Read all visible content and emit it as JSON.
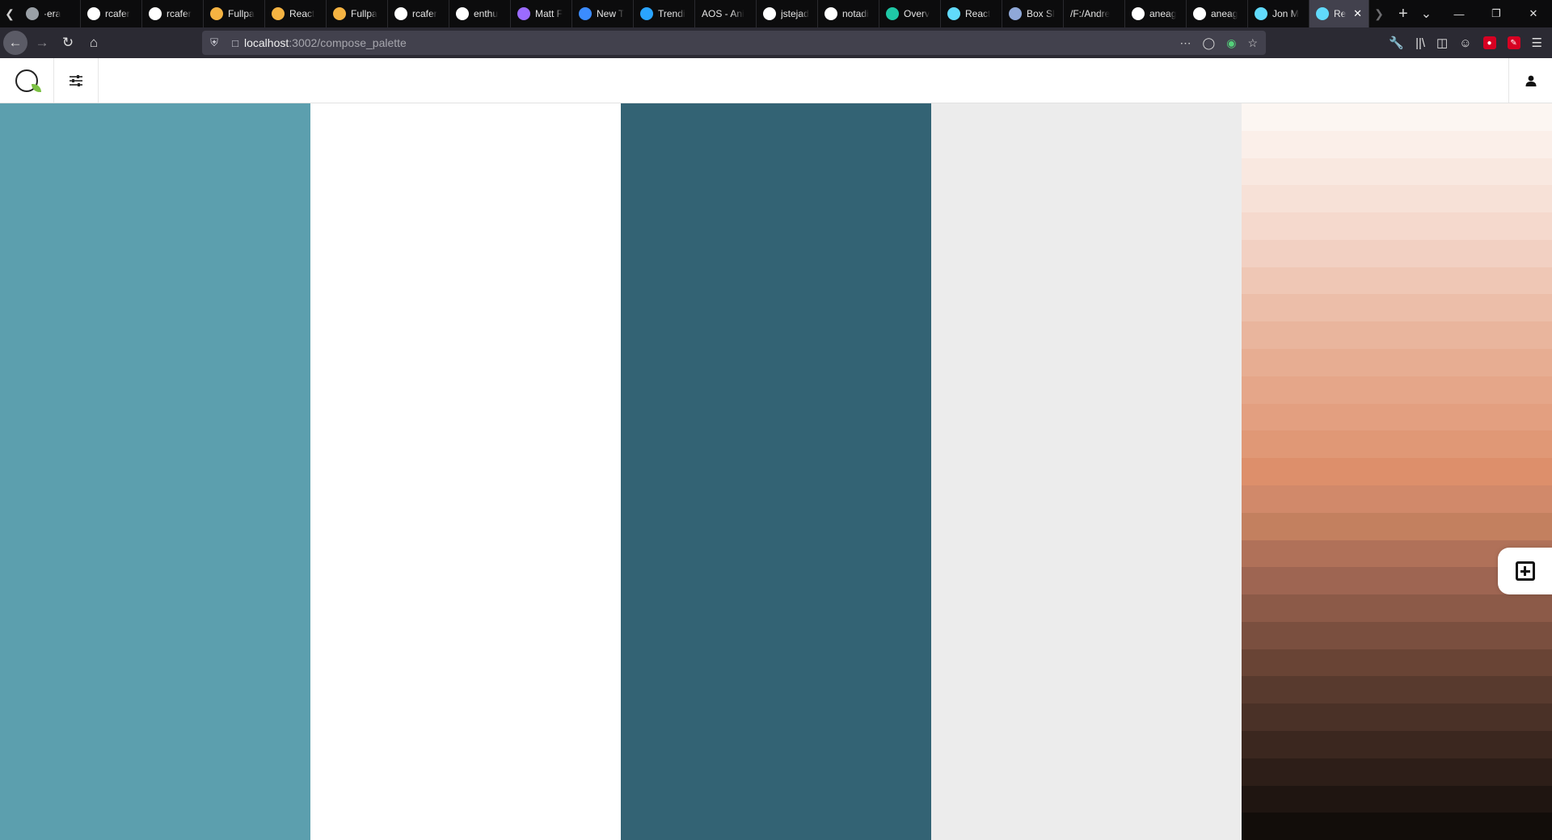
{
  "browser": {
    "tabs": [
      {
        "label": "·era",
        "icon": "generic-icon",
        "color": "#9aa0a6"
      },
      {
        "label": "rcafer",
        "icon": "github-icon",
        "color": "#ffffff"
      },
      {
        "label": "rcafer",
        "icon": "github-icon",
        "color": "#ffffff"
      },
      {
        "label": "Fullpa",
        "icon": "lightbulb-icon",
        "color": "#f5b342"
      },
      {
        "label": "React",
        "icon": "lightbulb-icon",
        "color": "#f5b342"
      },
      {
        "label": "Fullpa",
        "icon": "lightbulb-icon",
        "color": "#f5b342"
      },
      {
        "label": "rcafer",
        "icon": "github-icon",
        "color": "#ffffff"
      },
      {
        "label": "enthu",
        "icon": "google-icon",
        "color": "#ffffff"
      },
      {
        "label": "Matt F",
        "icon": "chart-icon",
        "color": "#9b6bff"
      },
      {
        "label": "New T",
        "icon": "firefox-icon",
        "color": "#3b8cff"
      },
      {
        "label": "Trendi",
        "icon": "circle-icon",
        "color": "#2aa4ff"
      },
      {
        "label": "AOS - Ani",
        "icon": "none",
        "color": ""
      },
      {
        "label": "jstejad",
        "icon": "github-icon",
        "color": "#ffffff"
      },
      {
        "label": "notadi",
        "icon": "github-icon",
        "color": "#ffffff"
      },
      {
        "label": "Overv",
        "icon": "diamond-icon",
        "color": "#1fc8a6"
      },
      {
        "label": "React",
        "icon": "react-icon",
        "color": "#61dafb"
      },
      {
        "label": "Box Sl",
        "icon": "window-icon",
        "color": "#8fa8d8"
      },
      {
        "label": "/F:/Andre",
        "icon": "none",
        "color": ""
      },
      {
        "label": "aneag",
        "icon": "github-icon",
        "color": "#ffffff"
      },
      {
        "label": "aneag",
        "icon": "github-icon",
        "color": "#ffffff"
      },
      {
        "label": "Jon M",
        "icon": "react-icon",
        "color": "#61dafb"
      },
      {
        "label": "Re",
        "icon": "react-icon",
        "color": "#61dafb",
        "active": true
      }
    ],
    "url": {
      "host": "localhost",
      "path": ":3002/compose_palette"
    }
  },
  "palette": {
    "swatches": [
      {
        "color": "#5c9fae",
        "width": 384
      },
      {
        "color": "#ffffff",
        "width": 384
      },
      {
        "color": "#336374",
        "width": 384
      },
      {
        "color": "#ececec",
        "width": 384
      }
    ],
    "gradient": [
      "#fcf6f2",
      "#fbefe9",
      "#f9e8e0",
      "#f7e1d7",
      "#f5d9cd",
      "#f2d0c2",
      "#efc7b5",
      "#ecbea9",
      "#e9b59d",
      "#e7ad92",
      "#e5a689",
      "#e39f80",
      "#e09876",
      "#dd8f6b",
      "#d1896a",
      "#c3805f",
      "#b07159",
      "#9e6552",
      "#8c5a48",
      "#7a4f3f",
      "#694435",
      "#583a2e",
      "#4a3127",
      "#3b271f",
      "#2d1e18",
      "#1f1511",
      "#120d0a"
    ]
  }
}
